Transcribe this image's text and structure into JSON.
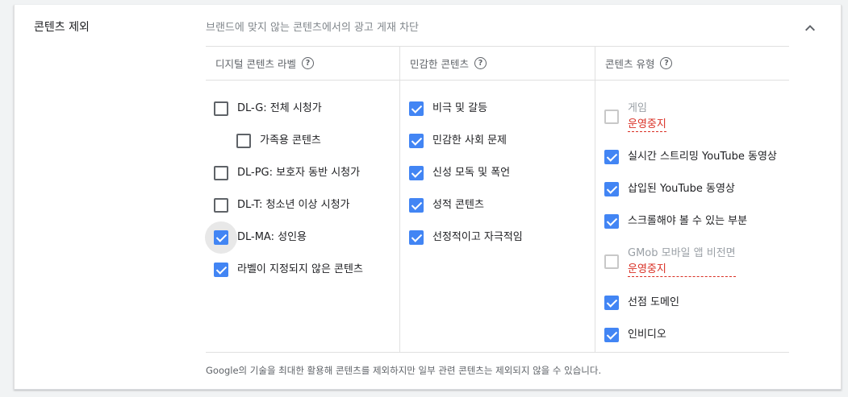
{
  "section": {
    "title": "콘텐츠 제외",
    "description": "브랜드에 맞지 않는 콘텐츠에서의 광고 게재 차단"
  },
  "columns": {
    "digital_labels": {
      "header": "디지털 콘텐츠 라벨",
      "items": [
        {
          "label": "DL-G: 전체 시청가",
          "checked": false
        },
        {
          "label": "가족용 콘텐츠",
          "checked": false
        },
        {
          "label": "DL-PG: 보호자 동반 시청가",
          "checked": false
        },
        {
          "label": "DL-T: 청소년 이상 시청가",
          "checked": false
        },
        {
          "label": "DL-MA: 성인용",
          "checked": true
        },
        {
          "label": "라벨이 지정되지 않은 콘텐츠",
          "checked": true
        }
      ]
    },
    "sensitive": {
      "header": "민감한 콘텐츠",
      "items": [
        {
          "label": "비극 및 갈등",
          "checked": true
        },
        {
          "label": "민감한 사회 문제",
          "checked": true
        },
        {
          "label": "신성 모독 및 폭언",
          "checked": true
        },
        {
          "label": "성적 콘텐츠",
          "checked": true
        },
        {
          "label": "선정적이고 자극적임",
          "checked": true
        }
      ]
    },
    "content_types": {
      "header": "콘텐츠 유형",
      "items": [
        {
          "label": "게임",
          "checked": false,
          "disabled": true,
          "note": "운영중지"
        },
        {
          "label": "실시간 스트리밍 YouTube 동영상",
          "checked": true
        },
        {
          "label": "삽입된 YouTube 동영상",
          "checked": true
        },
        {
          "label": "스크롤해야 볼 수 있는 부분",
          "checked": true
        },
        {
          "label": "GMob 모바일 앱 비전면",
          "checked": false,
          "disabled": true,
          "note": "운영중지"
        },
        {
          "label": "선점 도메인",
          "checked": true
        },
        {
          "label": "인비디오",
          "checked": true
        }
      ]
    }
  },
  "footer": {
    "note": "Google의 기술을 최대한 활용해 콘텐츠를 제외하지만 일부 관련 콘텐츠는 제외되지 않을 수 있습니다."
  },
  "icons": {
    "help": "help-circle-icon",
    "collapse": "chevron-up-icon"
  },
  "colors": {
    "checkbox_checked": "#4285f4",
    "suspended_text": "#d93025"
  }
}
